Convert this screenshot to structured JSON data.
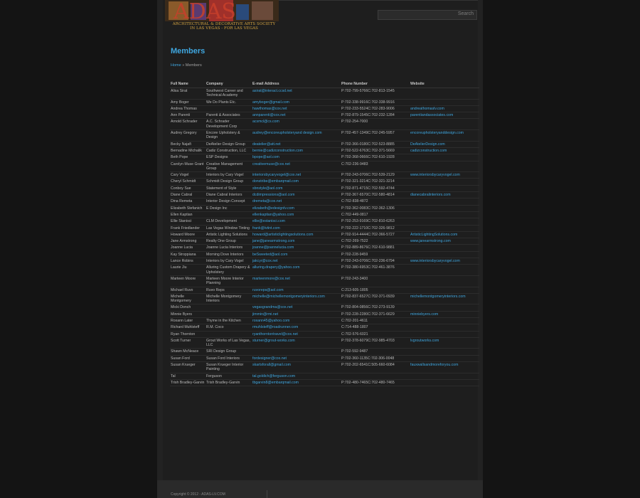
{
  "logo": {
    "text": "ARCHITECTURAL & DECORATIVE ARTS SOCIETY",
    "sub": "IN LAS VEGAS - FOR LAS VEGAS"
  },
  "search": {
    "button": "Search"
  },
  "page": {
    "title": "Members"
  },
  "breadcrumb": {
    "home": "Home",
    "sep": " » ",
    "current": "Members"
  },
  "table": {
    "headers": [
      "Full Name",
      "Company",
      "E-mail Address",
      "Phone Number",
      "Website"
    ],
    "rows": [
      [
        "Alisa Sirat",
        "Southwest Career and Technical Academy",
        "asirat@interact.ccsd.net",
        "P:702-799-5766C:702-813-1545",
        ""
      ],
      [
        "Amy Boger",
        "We Do Plants Etc.",
        "amyboger@gmail.com",
        "P:702-338-9916C:702-338-9916",
        ""
      ],
      [
        "Andrea Thomas",
        "",
        "hawthomas@cox.net",
        "P:702-233-5524C:702-283-9006",
        "andreathomaslv.com"
      ],
      [
        "Ann Parenti",
        "Parenti & Associates",
        "annparenti@cox.net",
        "P:702-879-1545C:702-232-1284",
        "parentiandassociates.com"
      ],
      [
        "Arnold Schrader",
        "A.C. Schrader Development Corp",
        "acsmcl@cs.com",
        "P:702-254-7000",
        ""
      ],
      [
        "Audrey Gregory",
        "Encore Upholstery & Design",
        "audrey@encoreupholsteryand design.com",
        "P:702-457-1349C:702-245-5957",
        "encoreupholsteryanddesign.com"
      ],
      [
        "Becky Najafi",
        "DeAtelier Design Group",
        "deatelier@att.net",
        "P:702-366-0180C:702-523-8885",
        "DeAtelierDesign.com"
      ],
      [
        "Bernadine Michalik",
        "Cadiz Construction, LLC",
        "bernie@cadizconstruction.com",
        "P:702-522-6763C:702-371-5669",
        "cadizconstruction.com"
      ],
      [
        "Beth Pope",
        "ESP Designs",
        "bpope@aol.com",
        "P:702-368-0666C:702-610-1928",
        ""
      ],
      [
        "Carolyn Muse Grant",
        "Creative Management Group",
        "creativemuse@cox.net",
        "C:702-236-9483",
        ""
      ],
      [
        "Cary Vogel",
        "Interiors by Cary Vogel",
        "interiorsbycaryvogel@cox.net",
        "P:702-243-0706C:702-539-2129",
        "www.interiorsbycaryvogel.com"
      ],
      [
        "Cheryl Schmidt",
        "Schmidt Design Group",
        "donstribe@embarqmail.com",
        "P:702-321-3214C:702-321-3214",
        ""
      ],
      [
        "Conboy Sue",
        "Statement of Style",
        "sbnstyle@aol.com",
        "P:702-871-4715C:702-592-4744",
        ""
      ],
      [
        "Diane Cabral",
        "Diane Cabral Interiors",
        "dcdimpressions@aol.com",
        "P:702-367-6570C:702-580-4814",
        "dianecabralinteriors.com"
      ],
      [
        "Dina Remeta",
        "Interior Design Concept",
        "dremeta@cox.net",
        "C:702-838-4872",
        ""
      ],
      [
        "Elizabeth Stefanich",
        "E Design Inc",
        "elizabeth@edesignlv.com",
        "P:702-362-0083C:702-362-1306",
        ""
      ],
      [
        "Ellen Kaptian",
        "",
        "ellenkaptian@yahoo.com",
        "C:702-449-0817",
        ""
      ],
      [
        "Ellie Stanisci",
        "CLM Development",
        "ellie@estanisci.com",
        "P:702-253-9169C:702-810-6263",
        ""
      ],
      [
        "Frank Friedlander",
        "Las Vegas Window Tinting",
        "frank@lvtint.com",
        "P:702-222-1710C:702-326-9812",
        ""
      ],
      [
        "Howard Moore",
        "Artistic Lighting Solutions",
        "howard@artisticlightingsolutions.com",
        "P:702-914-4444C:702-366-5727",
        "ArtisticLightingSolutions.com"
      ],
      [
        "Jane Armstrong",
        "Realty One Group",
        "jane@janearmstrong.com",
        "C:702-269-7522",
        "www.janearmstrong.com"
      ],
      [
        "Joanne Lucia",
        "Joanne Lucia Interiors",
        "joanne@joannelucia.com",
        "P:702-889-8676C:702-610-9881",
        ""
      ],
      [
        "Kay Stroppiana",
        "Morning Dove Interiors",
        "beSweeted@aol.com",
        "P:702-228-9459",
        ""
      ],
      [
        "Lance Robins",
        "Interiors by Cary Vogel",
        "jakcyr@cox.net",
        "P:702-243-0706C:702-236-6794",
        "www.interiorsbycaryvogel.com"
      ],
      [
        "Laurie Jiu",
        "Alluring Custom Drapery & Upholstery",
        "alluring.drapery@yahoo.com",
        "P:702-380-6953C:702-461-3876",
        ""
      ],
      [
        "Marteen Moore",
        "Marteen Moore Interior Planning",
        "marteenmore@cox.net",
        "P:702-243-3400",
        ""
      ],
      [
        "Michael Ruvo",
        "Ruvo Reps",
        "ruvoreps@aol.com",
        "C:213-605-1805",
        ""
      ],
      [
        "Michelle Montgomery",
        "Michelle Montgomery Interiors",
        "michelle@michellemontgomeryinteriors.com",
        "P:702-837-6527C:702-371-0939",
        "michellemontgomeryinteriors.com"
      ],
      [
        "Micki Donch",
        "",
        "vegasgrandma@cox.net",
        "P:702-804-0856C:702-273-9139",
        ""
      ],
      [
        "Minnie Byers",
        "",
        "jimmin@rmi.net",
        "P:702-228-2280C:702-371-6629",
        "minniebyers.com"
      ],
      [
        "Roxann Later",
        "Thyme in the Kitchen",
        "roxann45@yahoo.com",
        "C:702-201-4611",
        ""
      ],
      [
        "Richard Muhlsteff",
        "R.M. Coco",
        "rmuhlsteff@roadrunner.com",
        "C:714-488-1807",
        ""
      ],
      [
        "Ryan Thornton",
        "",
        "ryanthorntontravel@cox.net",
        "C:702-576-6021",
        ""
      ],
      [
        "Scott Turner",
        "Grout Works of Las Vegas, LLC",
        "sturner@grout-works.com",
        "P:702-378-6079C:702-985-4703",
        "lvgroutworks.com"
      ],
      [
        "Shawn McNeace",
        "SRI Design Group",
        "",
        "P:702-592-9487",
        ""
      ],
      [
        "Susan Ford",
        "Susan Ford Interiors",
        "fordesigner@cox.net",
        "P:702-360-1135C:702-306-0048",
        ""
      ],
      [
        "Susan Krueger",
        "Susan Krueger Interior Painting",
        "skartsforall@gmail.com",
        "P:702-202-6541C:505-660-6084",
        "fauxwallsandmoreforyou.com"
      ],
      [
        "Tal",
        "Ferguson",
        "tal.goldich@ferguson.com",
        "",
        ""
      ],
      [
        "Trish Bradley-Garvin",
        "Trish Bradley-Garvin",
        "tbgarvin8@embarqmail.com",
        "P:702-480-7465C:702-480-7465",
        ""
      ]
    ]
  },
  "footer": {
    "copyright": "Copyright © 2012 - ADAS-LV.COM"
  }
}
